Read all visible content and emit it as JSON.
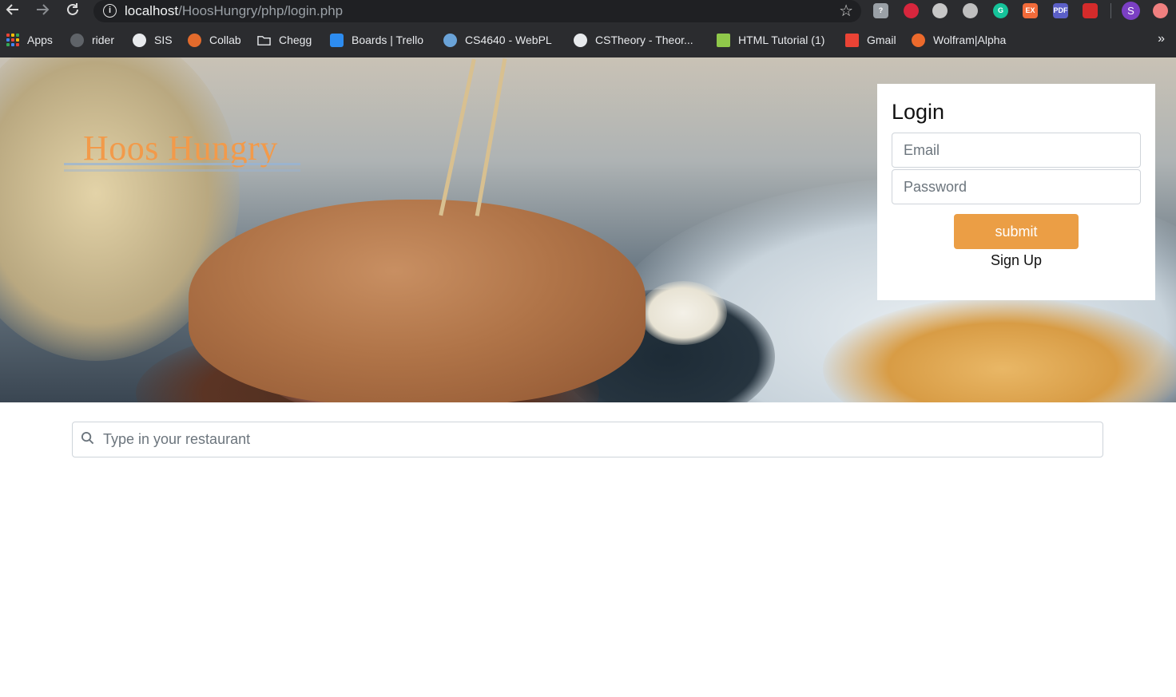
{
  "browser": {
    "url_host": "localhost",
    "url_path": "/HoosHungry/php/login.php",
    "nav": {
      "back_icon": "arrow-left-icon",
      "forward_icon": "arrow-right-icon",
      "reload_icon": "reload-icon"
    },
    "extensions": [
      {
        "name": "shield-extension-icon",
        "color": "#9aa0a6",
        "text": "?"
      },
      {
        "name": "adblock-extension-icon",
        "color": "#d7263d",
        "text": ""
      },
      {
        "name": "globe-extension-icon",
        "color": "#c7c7c7",
        "text": ""
      },
      {
        "name": "world-extension-icon",
        "color": "#bfbfbf",
        "text": ""
      },
      {
        "name": "grammarly-extension-icon",
        "color": "#15c39a",
        "text": "G"
      },
      {
        "name": "ex-extension-icon",
        "color": "#f26b3a",
        "text": "EX"
      },
      {
        "name": "pdf-extension-icon",
        "color": "#5b5fc7",
        "text": "PDF"
      },
      {
        "name": "acrobat-extension-icon",
        "color": "#d42b2b",
        "text": ""
      }
    ],
    "avatar_letter": "S",
    "bookmarks": [
      {
        "label": "Apps",
        "icon": "apps-grid-icon"
      },
      {
        "label": "rider",
        "icon": "rider-icon",
        "color": "#5f6368"
      },
      {
        "label": "SIS",
        "icon": "globe-icon",
        "color": "#e8eaed"
      },
      {
        "label": "Collab",
        "icon": "collab-icon",
        "color": "#e36b2c"
      },
      {
        "label": "Chegg",
        "icon": "folder-icon",
        "color": "#e8eaed"
      },
      {
        "label": "Boards | Trello",
        "icon": "trello-icon",
        "color": "#2d8cf0"
      },
      {
        "label": "CS4640 - WebPL",
        "icon": "webpl-icon",
        "color": "#6aa3d8"
      },
      {
        "label": "CSTheory - Theor...",
        "icon": "globe-icon",
        "color": "#e8eaed"
      },
      {
        "label": "HTML Tutorial (1)",
        "icon": "w3-icon",
        "color": "#8fc84a"
      },
      {
        "label": "Gmail",
        "icon": "gmail-icon",
        "color": "#ea4335"
      },
      {
        "label": "Wolfram|Alpha",
        "icon": "wolfram-icon",
        "color": "#ec6a2c"
      }
    ],
    "more_label": "»"
  },
  "hero": {
    "site_title": "Hoos Hungry"
  },
  "login": {
    "heading": "Login",
    "email_placeholder": "Email",
    "password_placeholder": "Password",
    "submit_label": "submit",
    "signup_label": "Sign Up",
    "accent_color": "#eb9e45"
  },
  "search": {
    "placeholder": "Type in your restaurant"
  }
}
